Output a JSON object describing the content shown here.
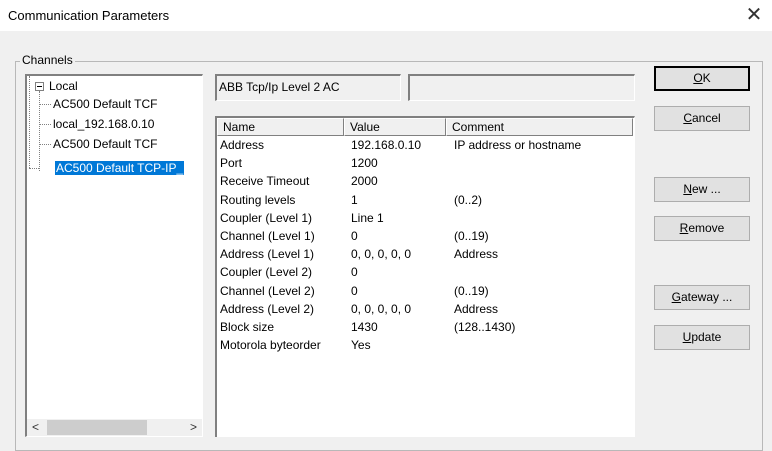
{
  "window": {
    "title": "Communication Parameters",
    "close_glyph": "✕"
  },
  "channels": {
    "label": "Channels",
    "tree": {
      "root": "Local",
      "children": [
        "AC500 Default TCF",
        "local_192.168.0.10",
        "AC500 Default TCF"
      ],
      "selected": "AC500 Default TCP-IP_"
    },
    "scroll_left": "<",
    "scroll_right": ">"
  },
  "driver": {
    "name": "ABB Tcp/Ip Level 2 AC",
    "secondary": ""
  },
  "table": {
    "columns": [
      "Name",
      "Value",
      "Comment"
    ],
    "rows": [
      [
        "Address",
        "192.168.0.10",
        "IP address or hostname"
      ],
      [
        "Port",
        "1200",
        ""
      ],
      [
        "Receive Timeout",
        "2000",
        ""
      ],
      [
        "Routing levels",
        "1",
        "(0..2)"
      ],
      [
        "Coupler (Level 1)",
        "Line 1",
        ""
      ],
      [
        "Channel (Level 1)",
        "0",
        "(0..19)"
      ],
      [
        "Address (Level 1)",
        "0, 0, 0, 0, 0",
        "Address"
      ],
      [
        "Coupler (Level 2)",
        "0",
        ""
      ],
      [
        "Channel (Level 2)",
        "0",
        "(0..19)"
      ],
      [
        "Address (Level 2)",
        "0, 0, 0, 0, 0",
        "Address"
      ],
      [
        "Block size",
        "1430",
        "(128..1430)"
      ],
      [
        "Motorola byteorder",
        "Yes",
        ""
      ]
    ]
  },
  "buttons": {
    "ok": {
      "mnemonic": "O",
      "rest": "K"
    },
    "cancel": {
      "mnemonic": "C",
      "rest": "ancel"
    },
    "new": {
      "mnemonic": "N",
      "rest": "ew ..."
    },
    "remove": {
      "mnemonic": "R",
      "rest": "emove"
    },
    "gateway": {
      "mnemonic": "G",
      "rest": "ateway ..."
    },
    "update": {
      "mnemonic": "U",
      "rest": "pdate"
    }
  }
}
